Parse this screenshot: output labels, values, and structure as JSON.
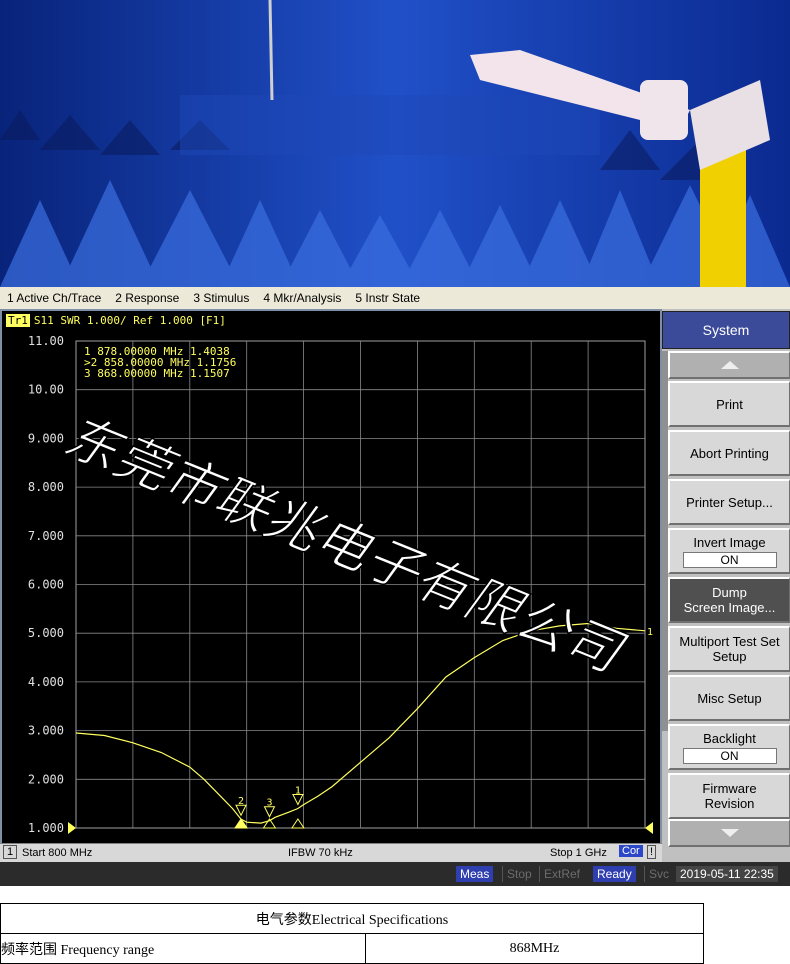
{
  "menu": [
    "1 Active Ch/Trace",
    "2 Response",
    "3 Stimulus",
    "4 Mkr/Analysis",
    "5 Instr State"
  ],
  "trace_header": {
    "tag": "Tr1",
    "text": "S11  SWR 1.000/ Ref 1.000 [F1]"
  },
  "markers": [
    {
      "label": " 1",
      "text": "878.00000 MHz  1.4038"
    },
    {
      "label": ">2",
      "text": "858.00000 MHz  1.1756"
    },
    {
      "label": " 3",
      "text": "868.00000 MHz  1.1507"
    }
  ],
  "status": {
    "channel": "1",
    "start": "Start 800 MHz",
    "ifbw": "IFBW 70 kHz",
    "stop": "Stop 1 GHz",
    "cor": "Cor",
    "bang": "!"
  },
  "bottom": {
    "meas": "Meas",
    "stop": "Stop",
    "extref": "ExtRef",
    "ready": "Ready",
    "svc": "Svc",
    "datetime": "2019-05-11 22:35"
  },
  "softkeys": {
    "system": "System",
    "print": "Print",
    "abort": "Abort Printing",
    "printer_setup": "Printer Setup...",
    "invert_image": "Invert Image",
    "invert_value": "ON",
    "dump": "Dump",
    "dump2": "Screen Image...",
    "multiport": "Multiport Test Set",
    "multiport2": "Setup",
    "misc": "Misc Setup",
    "backlight": "Backlight",
    "backlight_value": "ON",
    "firmware": "Firmware",
    "firmware2": "Revision"
  },
  "watermark": "东莞市联兆电子有限公司",
  "colors": {
    "trace": "#ffff60",
    "grid": "#8a8a8a",
    "screen": "#000000",
    "system_key": "#3c4a9a"
  },
  "chart_data": {
    "type": "line",
    "title": "",
    "x_unit": "MHz",
    "xlim": [
      800,
      1000
    ],
    "ylim": [
      1,
      11
    ],
    "y_ticks": [
      "1.000",
      "2.000",
      "3.000",
      "4.000",
      "5.000",
      "6.000",
      "7.000",
      "8.000",
      "9.000",
      "10.00",
      "11.00"
    ],
    "grid": true,
    "series": [
      {
        "x": [
          800,
          810,
          820,
          830,
          840,
          845,
          850,
          855,
          858,
          860,
          865,
          868,
          870,
          875,
          878,
          880,
          885,
          890,
          900,
          910,
          920,
          930,
          940,
          950,
          960,
          970,
          980,
          990,
          1000
        ],
        "values": [
          2.95,
          2.9,
          2.75,
          2.55,
          2.25,
          2.0,
          1.7,
          1.4,
          1.18,
          1.12,
          1.1,
          1.15,
          1.22,
          1.33,
          1.4,
          1.48,
          1.65,
          1.85,
          2.35,
          2.85,
          3.45,
          4.1,
          4.5,
          4.85,
          5.05,
          5.15,
          5.2,
          5.1,
          5.05
        ]
      }
    ]
  },
  "spec": {
    "title": "电气参数Electrical Specifications",
    "rows": [
      {
        "label": "频率范围  Frequency range",
        "value": "868MHz"
      }
    ]
  }
}
